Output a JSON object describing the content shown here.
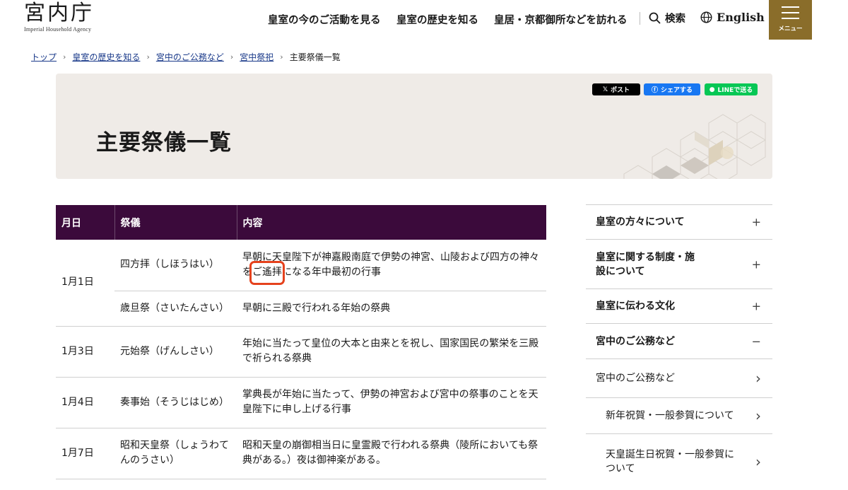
{
  "header": {
    "logo_main": "宮内庁",
    "logo_sub": "Imperial Household Agency",
    "nav": [
      {
        "label": "皇室の今のご活動を見る"
      },
      {
        "label": "皇室の歴史を知る"
      },
      {
        "label": "皇居・京都御所などを訪れる"
      }
    ],
    "search_label": "検索",
    "english_label": "English",
    "menu_label": "メニュー",
    "menu_color": "#8a6d2a"
  },
  "breadcrumb": {
    "items": [
      "トップ",
      "皇室の歴史を知る",
      "宮中のご公務など",
      "宮中祭祀"
    ],
    "current": "主要祭儀一覧"
  },
  "hero": {
    "title": "主要祭儀一覧",
    "share_x": "ポスト",
    "share_fb": "シェアする",
    "share_line": "LINEで送る"
  },
  "table": {
    "headers": [
      "月日",
      "祭儀",
      "内容"
    ],
    "header_color": "#3b0a3b",
    "rows": [
      {
        "date": "1月1日",
        "rite": "四方拝（しほうはい）",
        "content_pre": "早朝に天皇陛下が神嘉殿南庭で伊勢の神宮、山陵および四方の神々を",
        "content_hl": "ご遙拝",
        "content_post": "になる年中最初の行事"
      },
      {
        "rite": "歳旦祭（さいたんさい）",
        "content": "早朝に三殿で行われる年始の祭典"
      },
      {
        "date": "1月3日",
        "rite": "元始祭（げんしさい）",
        "content": "年始に当たって皇位の大本と由来とを祝し、国家国民の繁栄を三殿で祈られる祭典"
      },
      {
        "date": "1月4日",
        "rite": "奏事始（そうじはじめ）",
        "content": "掌典長が年始に当たって、伊勢の神宮および宮中の祭事のことを天皇陛下に申し上げる行事"
      },
      {
        "date": "1月7日",
        "rite": "昭和天皇祭（しょうわてんのうさい）",
        "content": "昭和天皇の崩御相当日に皇霊殿で行われる祭典（陵所においても祭典がある。）夜は御神楽がある。"
      }
    ]
  },
  "sidenav": {
    "items": [
      {
        "label": "皇室の方々について",
        "mark": "+"
      },
      {
        "label": "皇室に関する制度・施設について",
        "mark": "+"
      },
      {
        "label": "皇室に伝わる文化",
        "mark": "+"
      },
      {
        "label": "宮中のご公務など",
        "mark": "−"
      },
      {
        "label": "宮中のご公務など",
        "mark": "›"
      },
      {
        "label": "新年祝賀・一般参賀について",
        "mark": "›"
      },
      {
        "label": "天皇誕生日祝賀・一般参賀について",
        "mark": "›"
      }
    ]
  }
}
